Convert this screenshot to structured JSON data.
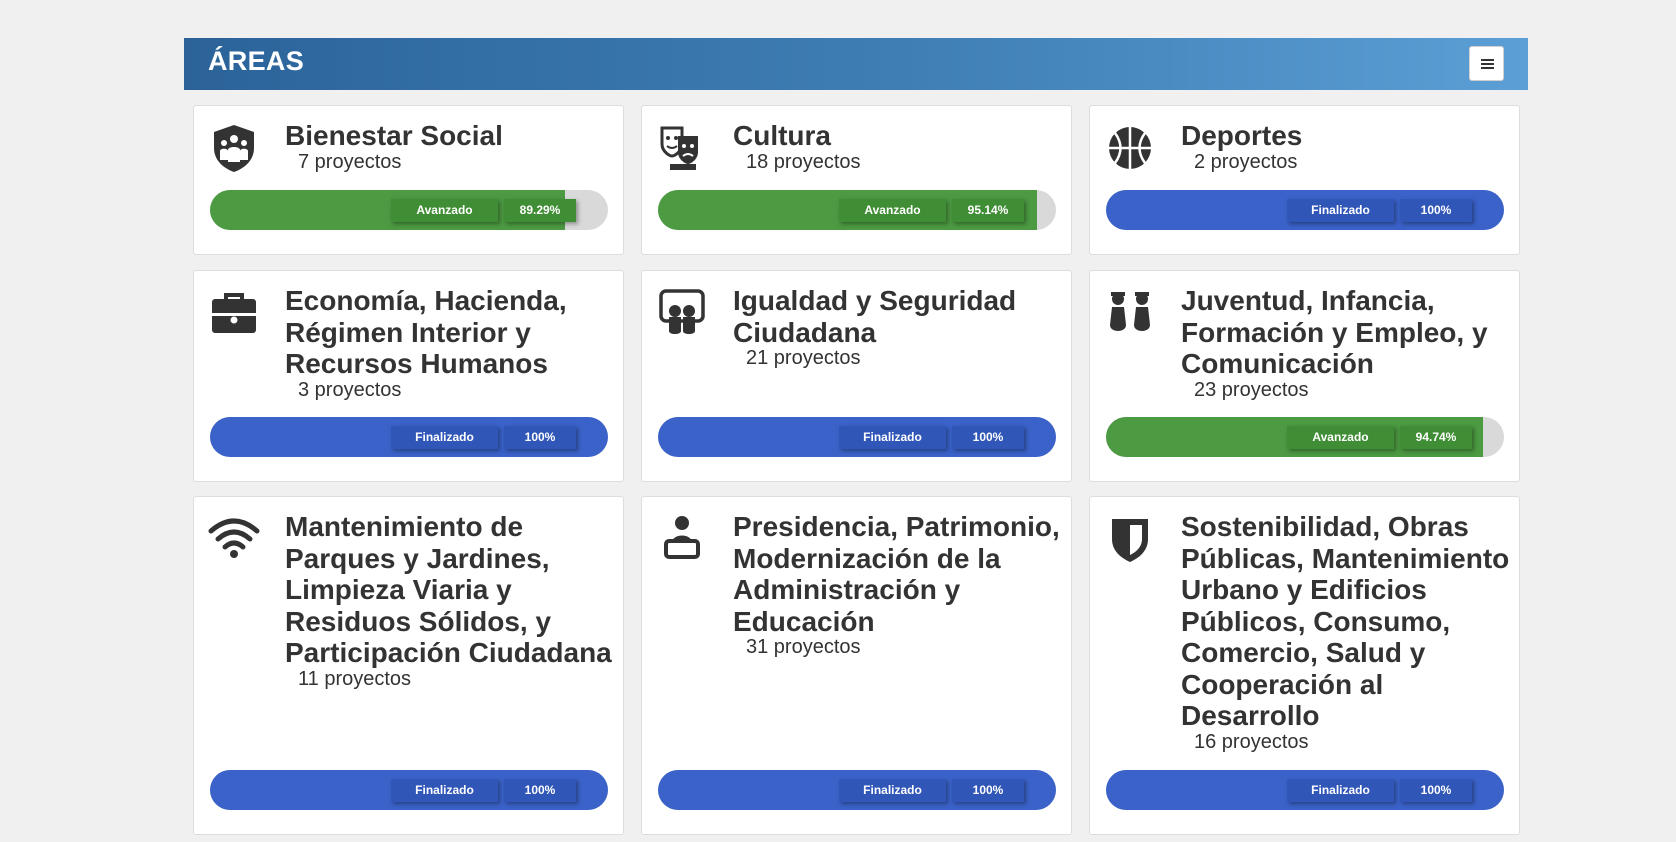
{
  "header": {
    "title": "ÁREAS",
    "menu_icon": "hamburger-icon"
  },
  "colors": {
    "green": "#4c9a42",
    "blue": "#3a62c9",
    "track": "#d9d9d9"
  },
  "areas": [
    {
      "name": "Bienestar Social",
      "count": "7 proyectos",
      "status": "Avanzado",
      "percent": "89.29%",
      "progress": 0.8929,
      "color": "green",
      "icon": "shield-people-icon"
    },
    {
      "name": "Cultura",
      "count": "18 proyectos",
      "status": "Avanzado",
      "percent": "95.14%",
      "progress": 0.9514,
      "color": "green",
      "icon": "theater-masks-icon"
    },
    {
      "name": "Deportes",
      "count": "2 proyectos",
      "status": "Finalizado",
      "percent": "100%",
      "progress": 1,
      "color": "blue",
      "icon": "basketball-icon"
    },
    {
      "name": "Economía, Hacienda, Régimen Interior y Recursos Humanos",
      "count": "3 proyectos",
      "status": "Finalizado",
      "percent": "100%",
      "progress": 1,
      "color": "blue",
      "icon": "briefcase-icon"
    },
    {
      "name": "Igualdad y Seguridad Ciudadana",
      "count": "21 proyectos",
      "status": "Finalizado",
      "percent": "100%",
      "progress": 1,
      "color": "blue",
      "icon": "equality-icon"
    },
    {
      "name": "Juventud, Infancia, Formación y Empleo, y Comunicación",
      "count": "23 proyectos",
      "status": "Avanzado",
      "percent": "94.74%",
      "progress": 0.9474,
      "color": "green",
      "icon": "children-icon"
    },
    {
      "name": "Mantenimiento de Parques y Jardines, Limpieza Viaria y Residuos Sólidos, y Participación Ciudadana",
      "count": "11 proyectos",
      "status": "Finalizado",
      "percent": "100%",
      "progress": 1,
      "color": "blue",
      "icon": "wifi-icon"
    },
    {
      "name": "Presidencia, Patrimonio, Modernización de la Administración y Educación",
      "count": "31 proyectos",
      "status": "Finalizado",
      "percent": "100%",
      "progress": 1,
      "color": "blue",
      "icon": "speaker-podium-icon"
    },
    {
      "name": "Sostenibilidad, Obras Públicas, Mantenimiento Urbano y Edificios Públicos, Consumo, Comercio, Salud y Cooperación al Desarrollo",
      "count": "16 proyectos",
      "status": "Finalizado",
      "percent": "100%",
      "progress": 1,
      "color": "blue",
      "icon": "shield-icon"
    }
  ]
}
